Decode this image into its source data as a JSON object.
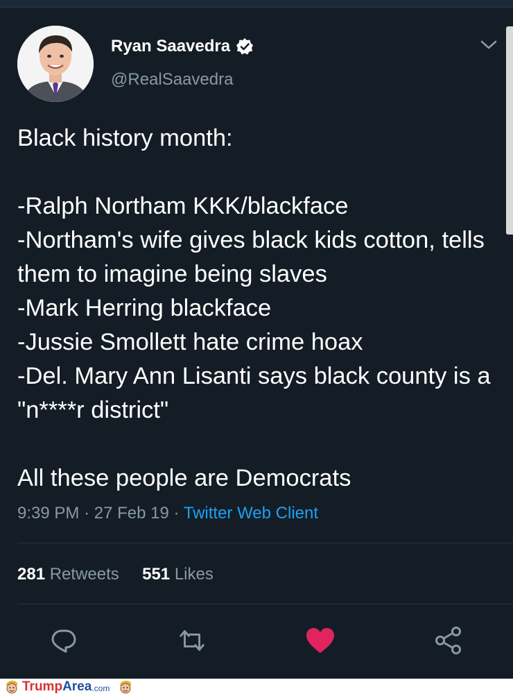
{
  "tweet": {
    "display_name": "Ryan Saavedra",
    "handle": "@RealSaavedra",
    "text": "Black history month:\n\n-Ralph Northam KKK/blackface\n-Northam's wife gives black kids cotton, tells them to imagine being slaves\n-Mark Herring blackface\n-Jussie Smollett hate crime hoax\n-Del. Mary Ann Lisanti says black county is a \"n****r district\"\n\nAll these people are Democrats",
    "time": "9:39 PM",
    "sep1": "·",
    "date": "27 Feb 19",
    "sep2": "·",
    "client": "Twitter Web Client",
    "retweets_count": "281",
    "retweets_label": "Retweets",
    "likes_count": "551",
    "likes_label": "Likes"
  },
  "icons": {
    "verified": "verified-badge-icon",
    "menu": "chevron-down-icon",
    "reply": "reply-icon",
    "retweet": "retweet-icon",
    "like": "heart-icon",
    "share": "share-icon"
  },
  "colors": {
    "background": "#141d26",
    "secondary_text": "#8899a6",
    "link": "#1da1f2",
    "like": "#e0245e"
  },
  "footer": {
    "brand_part1": "Trump",
    "brand_part2": "Area",
    "brand_domain": ".com"
  }
}
